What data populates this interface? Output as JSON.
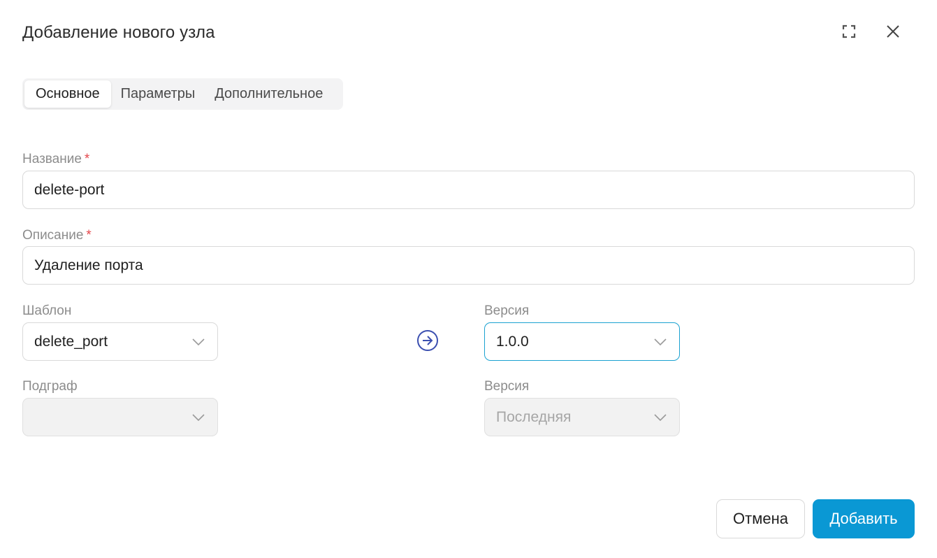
{
  "dialog": {
    "title": "Добавление нового узла",
    "icons": {
      "expand": "expand-icon",
      "close": "close-icon"
    }
  },
  "tabs": [
    {
      "label": "Основное",
      "active": true
    },
    {
      "label": "Параметры",
      "active": false
    },
    {
      "label": "Дополнительное",
      "active": false
    }
  ],
  "form": {
    "name": {
      "label": "Название",
      "required_mark": "*",
      "value": "delete-port"
    },
    "description": {
      "label": "Описание",
      "required_mark": "*",
      "value": "Удаление порта"
    },
    "template": {
      "label": "Шаблон",
      "value": "delete_port"
    },
    "template_version": {
      "label": "Версия",
      "value": "1.0.0"
    },
    "subgraph": {
      "label": "Подграф",
      "value": ""
    },
    "subgraph_version": {
      "label": "Версия",
      "placeholder": "Последняя"
    },
    "link_icon": "arrow-right-circle-icon"
  },
  "footer": {
    "cancel_label": "Отмена",
    "submit_label": "Добавить"
  },
  "colors": {
    "accent": "#0a98d4",
    "focus_border": "#1ba2d1",
    "required": "#e5484d",
    "link_icon": "#3b4fb0"
  }
}
